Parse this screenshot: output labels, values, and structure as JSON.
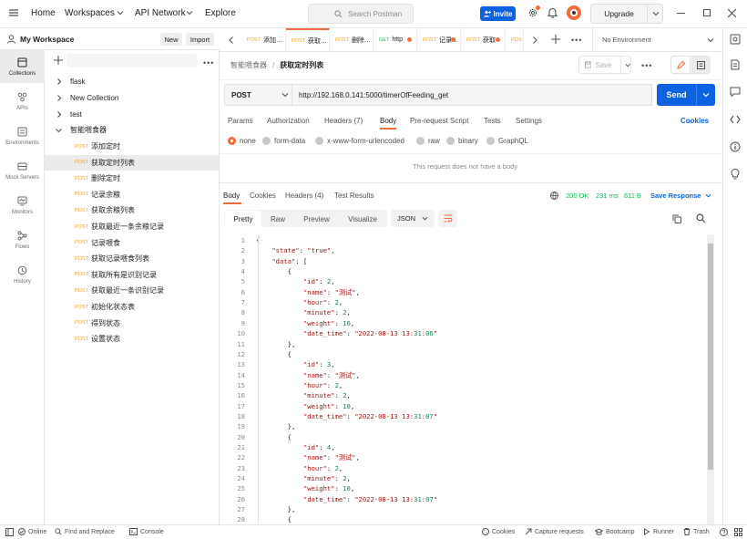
{
  "topbar": {
    "nav": [
      "Home",
      "Workspaces",
      "API Network",
      "Explore"
    ],
    "search_placeholder": "Search Postman",
    "invite_label": "Invite",
    "upgrade_label": "Upgrade"
  },
  "workspace": {
    "name": "My Workspace",
    "new_label": "New",
    "import_label": "Import"
  },
  "rail": [
    "Collections",
    "APIs",
    "Environments",
    "Mock Servers",
    "Monitors",
    "Flows",
    "History"
  ],
  "collections": [
    {
      "name": "flask"
    },
    {
      "name": "New Collection"
    },
    {
      "name": "test"
    },
    {
      "name": "智能喂食器"
    }
  ],
  "requests": [
    {
      "method": "POST",
      "name": "添加定时"
    },
    {
      "method": "POST",
      "name": "获取定时列表"
    },
    {
      "method": "POST",
      "name": "删除定时"
    },
    {
      "method": "POST",
      "name": "记录余粮"
    },
    {
      "method": "POST",
      "name": "获取余粮列表"
    },
    {
      "method": "POST",
      "name": "获取最近一条余粮记录"
    },
    {
      "method": "POST",
      "name": "记录喂食"
    },
    {
      "method": "POST",
      "name": "获取记录喂食列表"
    },
    {
      "method": "POST",
      "name": "获取所有是识别记录"
    },
    {
      "method": "POST",
      "name": "获取最近一条识别记录"
    },
    {
      "method": "POST",
      "name": "初始化状态表"
    },
    {
      "method": "POST",
      "name": "得到状态"
    },
    {
      "method": "POST",
      "name": "设置状态"
    }
  ],
  "tabs": [
    {
      "method": "POST",
      "name": "添加…"
    },
    {
      "method": "POST",
      "name": "获取…"
    },
    {
      "method": "POST",
      "name": "删除…"
    },
    {
      "method": "GET",
      "name": "http"
    },
    {
      "method": "POST",
      "name": "记录…"
    },
    {
      "method": "POST",
      "name": "获取"
    },
    {
      "method": "POST",
      "name": ""
    }
  ],
  "environment": "No Environment",
  "breadcrumb": {
    "parent": "智能喂食器",
    "current": "获取定时列表"
  },
  "save_label": "Save",
  "request": {
    "method": "POST",
    "url": "http://192.168.0.141:5000/timerOfFeeding_get",
    "send_label": "Send",
    "subtabs": [
      "Params",
      "Authorization",
      "Headers (7)",
      "Body",
      "Pre-request Script",
      "Tests",
      "Settings"
    ],
    "cookies_label": "Cookies",
    "body_types": [
      "none",
      "form-data",
      "x-www-form-urlencoded",
      "raw",
      "binary",
      "GraphQL"
    ],
    "no_body_text": "This request does not have a body"
  },
  "response": {
    "tabs": [
      "Body",
      "Cookies",
      "Headers (4)",
      "Test Results"
    ],
    "status": "200 OK",
    "time": "231 ms",
    "size": "611 B",
    "save_response_label": "Save Response",
    "views": [
      "Pretty",
      "Raw",
      "Preview",
      "Visualize"
    ],
    "format": "JSON"
  },
  "code_lines": [
    "{",
    "    \"state\": \"true\",",
    "    \"data\": [",
    "        {",
    "            \"id\": 2,",
    "            \"name\": \"测试\",",
    "            \"hour\": 2,",
    "            \"minute\": 2,",
    "            \"weight\": 10,",
    "            \"date_time\": \"2022-08-13 13:31:06\"",
    "        },",
    "        {",
    "            \"id\": 3,",
    "            \"name\": \"测试\",",
    "            \"hour\": 2,",
    "            \"minute\": 2,",
    "            \"weight\": 10,",
    "            \"date_time\": \"2022-08-13 13:31:07\"",
    "        },",
    "        {",
    "            \"id\": 4,",
    "            \"name\": \"测试\",",
    "            \"hour\": 2,",
    "            \"minute\": 2,",
    "            \"weight\": 10,",
    "            \"date_time\": \"2022-08-13 13:31:07\"",
    "        },",
    "        {"
  ],
  "statusbar": {
    "online": "Online",
    "find_replace": "Find and Replace",
    "console": "Console",
    "cookies": "Cookies",
    "capture": "Capture requests",
    "bootcamp": "Bootcamp",
    "runner": "Runner",
    "trash": "Trash"
  },
  "colors": {
    "accent": "#0c62e0",
    "method_post": "#f6a026",
    "method_get": "#0cbb52",
    "active_tab": "#f26b3a",
    "status_ok": "#0cbb52"
  }
}
